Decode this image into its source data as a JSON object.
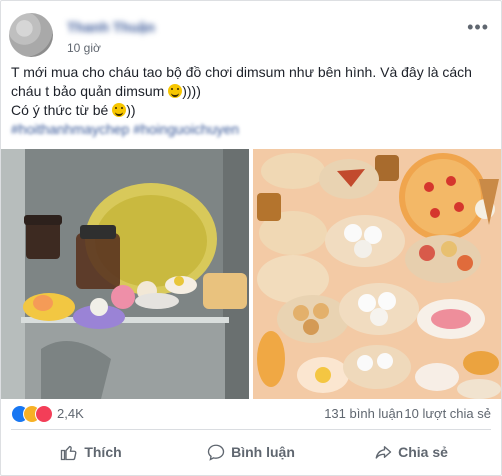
{
  "post": {
    "author": "Thanh Thuận",
    "time": "10 giờ",
    "text_line1": "T mới mua cho cháu tao bộ đồ chơi dimsum như bên hình. Và đây là cách",
    "text_line2": "cháu t bảo quản dimsum",
    "text_line2_suffix": "))))",
    "text_line3": "Có ý thức từ bé",
    "text_line3_suffix": "))",
    "hashtags": "#hoithanhmaychep #hoinguoichuyen"
  },
  "stats": {
    "reactions": "2,4K",
    "comments": "131 bình luận",
    "shares": "10 lượt chia sẻ"
  },
  "actions": {
    "like": "Thích",
    "comment": "Bình luận",
    "share": "Chia sẻ"
  },
  "colors": {
    "link": "#385898",
    "like": "#1877f2",
    "love": "#f33e58",
    "haha": "#f7b125"
  }
}
